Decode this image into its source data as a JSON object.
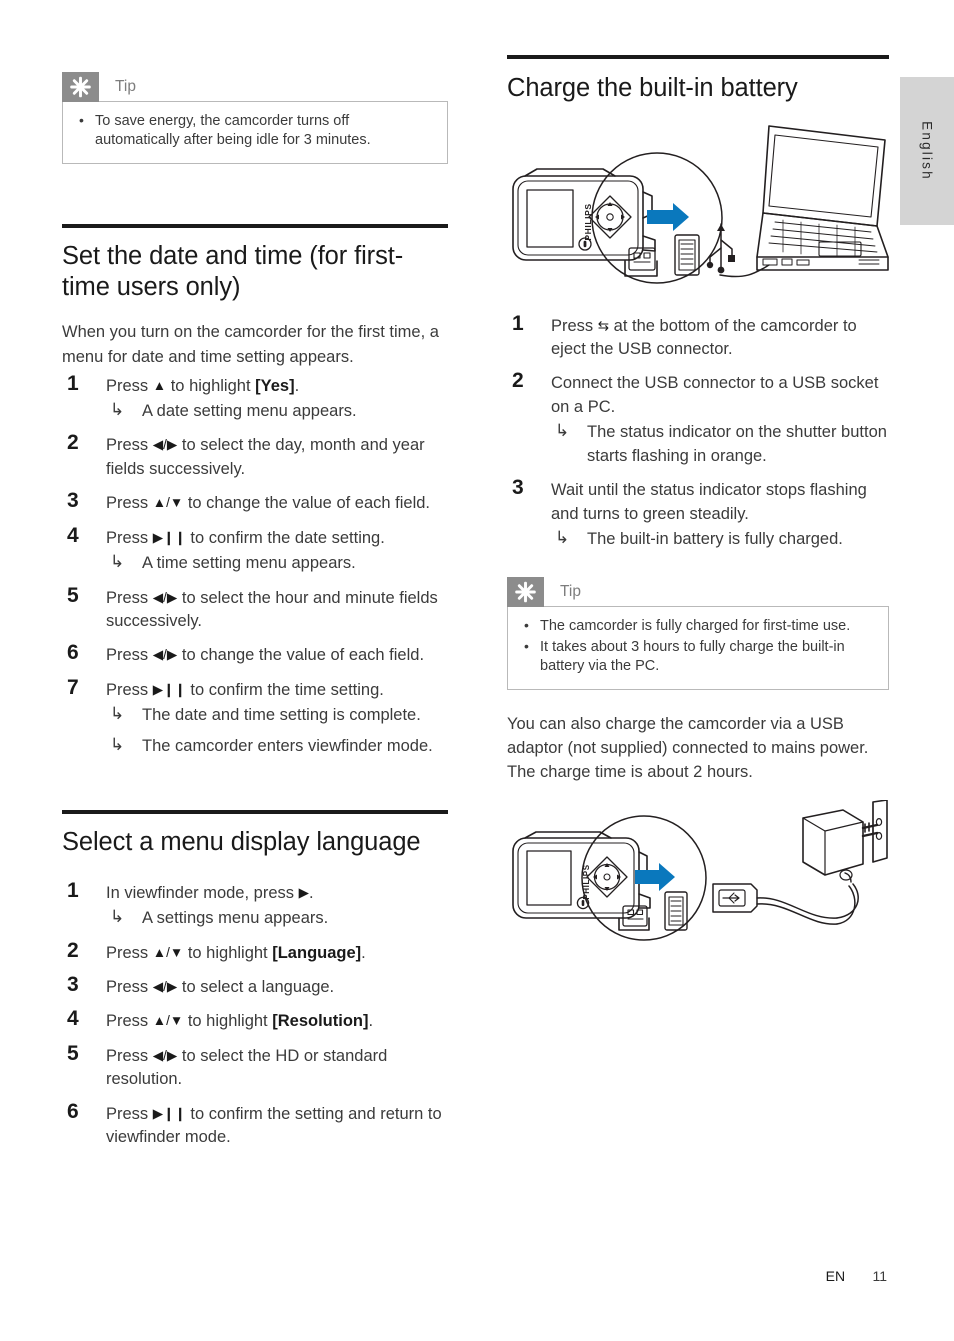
{
  "page": {
    "language_tab": "English",
    "footer_locale": "EN",
    "footer_page_number": "11"
  },
  "left_column": {
    "tip": {
      "icon": "asterisk-icon",
      "label": "Tip",
      "items": [
        "To save energy, the camcorder turns off automatically after being idle for 3 minutes."
      ]
    },
    "section_datetime": {
      "heading": "Set the date and time (for first-time users only)",
      "intro": "When you turn on the camcorder for the first time, a menu for date and time setting appears.",
      "steps": [
        {
          "parts": [
            {
              "t": "text",
              "v": "Press "
            },
            {
              "t": "sym",
              "v": "▲"
            },
            {
              "t": "text",
              "v": " to highlight "
            },
            {
              "t": "bold",
              "v": "[Yes]"
            },
            {
              "t": "text",
              "v": "."
            }
          ],
          "results": [
            "A date setting menu appears."
          ]
        },
        {
          "parts": [
            {
              "t": "text",
              "v": "Press "
            },
            {
              "t": "sym",
              "v": "◀/▶"
            },
            {
              "t": "text",
              "v": " to select the day, month and year fields successively."
            }
          ],
          "results": []
        },
        {
          "parts": [
            {
              "t": "text",
              "v": "Press "
            },
            {
              "t": "sym",
              "v": "▲/▼"
            },
            {
              "t": "text",
              "v": " to change the value of each field."
            }
          ],
          "results": []
        },
        {
          "parts": [
            {
              "t": "text",
              "v": "Press "
            },
            {
              "t": "sym",
              "v": "▶❙❙"
            },
            {
              "t": "text",
              "v": " to confirm the date setting."
            }
          ],
          "results": [
            "A time setting menu appears."
          ]
        },
        {
          "parts": [
            {
              "t": "text",
              "v": "Press "
            },
            {
              "t": "sym",
              "v": "◀/▶"
            },
            {
              "t": "text",
              "v": " to select the hour and minute fields successively."
            }
          ],
          "results": []
        },
        {
          "parts": [
            {
              "t": "text",
              "v": "Press "
            },
            {
              "t": "sym",
              "v": "◀/▶"
            },
            {
              "t": "text",
              "v": " to change the value of each field."
            }
          ],
          "results": []
        },
        {
          "parts": [
            {
              "t": "text",
              "v": "Press "
            },
            {
              "t": "sym",
              "v": "▶❙❙"
            },
            {
              "t": "text",
              "v": " to confirm the time setting."
            }
          ],
          "results": [
            "The date and time setting is complete.",
            "The camcorder enters viewfinder mode."
          ]
        }
      ]
    },
    "section_language": {
      "heading": "Select a menu display language",
      "steps": [
        {
          "parts": [
            {
              "t": "text",
              "v": "In viewfinder mode, press "
            },
            {
              "t": "sym",
              "v": "▶"
            },
            {
              "t": "text",
              "v": "."
            }
          ],
          "results": [
            "A settings menu appears."
          ]
        },
        {
          "parts": [
            {
              "t": "text",
              "v": "Press "
            },
            {
              "t": "sym",
              "v": "▲/▼"
            },
            {
              "t": "text",
              "v": " to highlight "
            },
            {
              "t": "bold",
              "v": "[Language]"
            },
            {
              "t": "text",
              "v": "."
            }
          ],
          "results": []
        },
        {
          "parts": [
            {
              "t": "text",
              "v": "Press "
            },
            {
              "t": "sym",
              "v": "◀/▶"
            },
            {
              "t": "text",
              "v": " to select a language."
            }
          ],
          "results": []
        },
        {
          "parts": [
            {
              "t": "text",
              "v": "Press "
            },
            {
              "t": "sym",
              "v": "▲/▼"
            },
            {
              "t": "text",
              "v": " to highlight "
            },
            {
              "t": "bold",
              "v": "[Resolution]"
            },
            {
              "t": "text",
              "v": "."
            }
          ],
          "results": []
        },
        {
          "parts": [
            {
              "t": "text",
              "v": "Press "
            },
            {
              "t": "sym",
              "v": "◀/▶"
            },
            {
              "t": "text",
              "v": " to select the HD or standard resolution."
            }
          ],
          "results": []
        },
        {
          "parts": [
            {
              "t": "text",
              "v": "Press "
            },
            {
              "t": "sym",
              "v": "▶❙❙"
            },
            {
              "t": "text",
              "v": " to confirm the setting and return to viewfinder mode."
            }
          ],
          "results": []
        }
      ]
    }
  },
  "right_column": {
    "section_charge": {
      "heading": "Charge the built-in battery",
      "figure_pc": {
        "name": "camcorder-to-laptop-usb-diagram",
        "brand_label": "PHILIPS",
        "arrow_color": "#0a78bd",
        "elements": [
          "camcorder",
          "usb-connector",
          "usb-socket",
          "usb-symbol",
          "laptop"
        ]
      },
      "steps": [
        {
          "parts": [
            {
              "t": "text",
              "v": "Press "
            },
            {
              "t": "sym",
              "v": "⇆"
            },
            {
              "t": "text",
              "v": " at the bottom of the camcorder to eject the USB connector."
            }
          ],
          "results": []
        },
        {
          "parts": [
            {
              "t": "text",
              "v": "Connect the USB connector to a USB socket on a PC."
            }
          ],
          "results": [
            "The status indicator on the shutter button starts flashing in orange."
          ]
        },
        {
          "parts": [
            {
              "t": "text",
              "v": "Wait until the status indicator stops flashing and turns to green steadily."
            }
          ],
          "results": [
            "The built-in battery is fully charged."
          ]
        }
      ],
      "tip": {
        "icon": "asterisk-icon",
        "label": "Tip",
        "items": [
          "The camcorder is fully charged for first-time use.",
          "It takes about 3 hours to fully charge the built-in battery via the PC."
        ]
      },
      "paragraph_adaptor": "You can also charge the camcorder via a USB adaptor (not supplied) connected to mains power. The charge time is about 2 hours.",
      "figure_adaptor": {
        "name": "camcorder-to-wall-adaptor-diagram",
        "brand_label": "PHILIPS",
        "arrow_color": "#0a78bd",
        "elements": [
          "camcorder",
          "usb-connector",
          "usb-socket",
          "usb-cable",
          "power-adaptor",
          "wall-outlet"
        ]
      }
    }
  }
}
